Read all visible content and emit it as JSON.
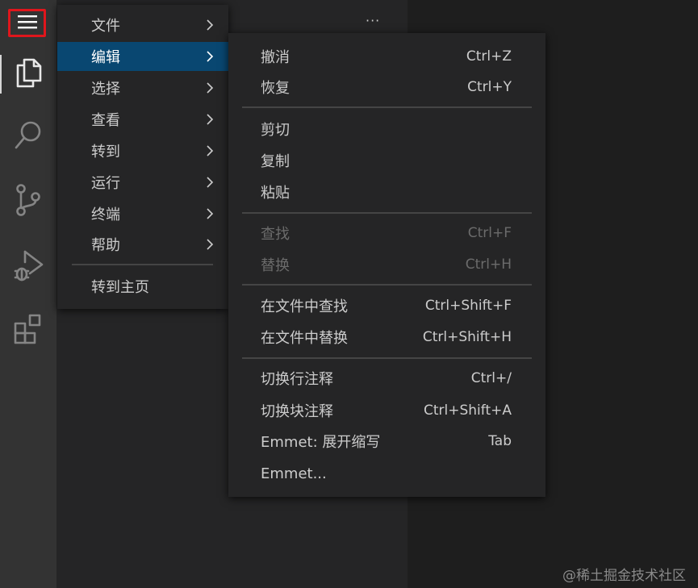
{
  "activity_bar": {
    "icons": [
      "menu-icon",
      "files-icon",
      "search-icon",
      "source-control-icon",
      "run-debug-icon",
      "extensions-icon"
    ],
    "active": "files-icon",
    "highlight_color": "#e0161c"
  },
  "sidebar": {
    "more_label": "···"
  },
  "main_menu": {
    "items": [
      {
        "label": "文件"
      },
      {
        "label": "编辑"
      },
      {
        "label": "选择"
      },
      {
        "label": "查看"
      },
      {
        "label": "转到"
      },
      {
        "label": "运行"
      },
      {
        "label": "终端"
      },
      {
        "label": "帮助"
      },
      {
        "label": "转到主页"
      }
    ],
    "active_item": "编辑",
    "active_color": "#094771"
  },
  "edit_submenu": {
    "items": [
      {
        "label": "撤消",
        "shortcut": "Ctrl+Z"
      },
      {
        "label": "恢复",
        "shortcut": "Ctrl+Y"
      },
      {
        "label": "剪切",
        "shortcut": ""
      },
      {
        "label": "复制",
        "shortcut": ""
      },
      {
        "label": "粘贴",
        "shortcut": ""
      },
      {
        "label": "查找",
        "shortcut": "Ctrl+F",
        "disabled": true
      },
      {
        "label": "替换",
        "shortcut": "Ctrl+H",
        "disabled": true
      },
      {
        "label": "在文件中查找",
        "shortcut": "Ctrl+Shift+F"
      },
      {
        "label": "在文件中替换",
        "shortcut": "Ctrl+Shift+H"
      },
      {
        "label": "切换行注释",
        "shortcut": "Ctrl+/"
      },
      {
        "label": "切换块注释",
        "shortcut": "Ctrl+Shift+A"
      },
      {
        "label": "Emmet: 展开缩写",
        "shortcut": "Tab"
      },
      {
        "label": "Emmet...",
        "shortcut": ""
      }
    ]
  },
  "watermark": "@稀土掘金技术社区"
}
